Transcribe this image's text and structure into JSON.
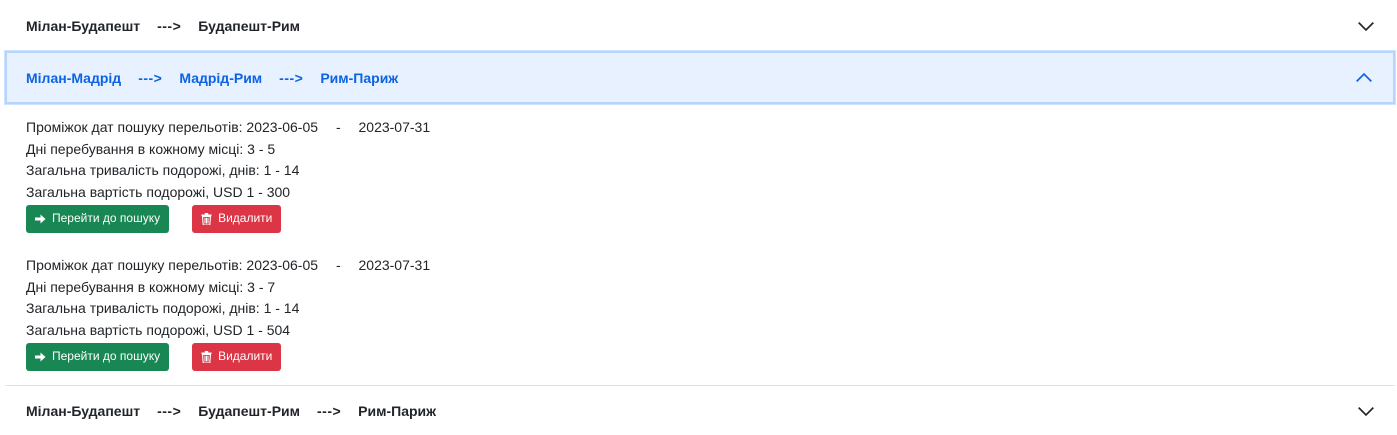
{
  "routes": [
    {
      "stops": [
        "Мілан-Будапешт",
        "Будапешт-Рим"
      ],
      "arrows": [
        "--->"
      ],
      "expanded": false
    },
    {
      "stops": [
        "Мілан-Мадрід",
        "Мадрід-Рим",
        "Рим-Париж"
      ],
      "arrows": [
        "--->",
        "--->"
      ],
      "expanded": true,
      "entries": [
        {
          "search_range_label": "Проміжок дат пошуку перельотів:",
          "date_from": "2023-06-05",
          "date_sep": "-",
          "date_to": "2023-07-31",
          "stay_line": "Дні перебування в кожному місці: 3 - 5",
          "duration_line": "Загальна тривалість подорожі, днів: 1 - 14",
          "cost_line": "Загальна вартість подорожі, USD 1 - 300",
          "search_button": "Перейти до пошуку",
          "delete_button": "Видалити"
        },
        {
          "search_range_label": "Проміжок дат пошуку перельотів:",
          "date_from": "2023-06-05",
          "date_sep": "-",
          "date_to": "2023-07-31",
          "stay_line": "Дні перебування в кожному місці: 3 - 7",
          "duration_line": "Загальна тривалість подорожі, днів: 1 - 14",
          "cost_line": "Загальна вартість подорожі, USD 1 - 504",
          "search_button": "Перейти до пошуку",
          "delete_button": "Видалити"
        }
      ]
    },
    {
      "stops": [
        "Мілан-Будапешт",
        "Будапешт-Рим",
        "Рим-Париж"
      ],
      "arrows": [
        "--->",
        "--->"
      ],
      "expanded": false
    }
  ],
  "icons": {
    "chevron_down": "chevron-down-icon",
    "chevron_up": "chevron-up-icon",
    "search_arrow": "arrow-right-icon",
    "delete": "trash-icon"
  },
  "colors": {
    "active_header_bg": "#e7f1ff",
    "active_header_text": "#0c63e4",
    "search_button": "#198754",
    "delete_button": "#dc3545"
  }
}
